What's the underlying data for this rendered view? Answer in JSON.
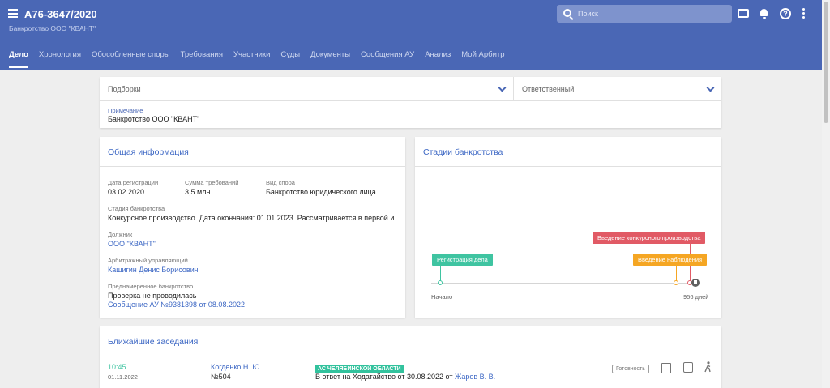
{
  "header": {
    "case_number": "А76-3647/2020",
    "subtitle": "Банкротство ООО \"КВАНТ\"",
    "search_placeholder": "Поиск",
    "tabs": [
      {
        "label": "Дело",
        "active": true
      },
      {
        "label": "Хронология",
        "active": false
      },
      {
        "label": "Обособленные споры",
        "active": false
      },
      {
        "label": "Требования",
        "active": false
      },
      {
        "label": "Участники",
        "active": false
      },
      {
        "label": "Суды",
        "active": false
      },
      {
        "label": "Документы",
        "active": false
      },
      {
        "label": "Сообщения АУ",
        "active": false
      },
      {
        "label": "Анализ",
        "active": false
      },
      {
        "label": "Мой Арбитр",
        "active": false
      }
    ],
    "help_glyph": "?",
    "icons": [
      "menu-icon",
      "search-icon",
      "chat-icon",
      "bell-icon",
      "help-icon",
      "more-icon"
    ]
  },
  "filters": {
    "collections_label": "Подборки",
    "responsible_label": "Ответственный",
    "note_label": "Примечание",
    "note_value": "Банкротство ООО \"КВАНТ\""
  },
  "info": {
    "title": "Общая информация",
    "reg_date_label": "Дата регистрации",
    "reg_date": "03.02.2020",
    "claims_label": "Сумма требований",
    "claims": "3,5 млн",
    "dispute_label": "Вид спора",
    "dispute": "Банкротство юридического лица",
    "stage_label": "Стадия банкротства",
    "stage": "Конкурсное производство. Дата окончания: 01.01.2023. Рассматривается в первой и...",
    "debtor_label": "Должник",
    "debtor": "ООО \"КВАНТ\"",
    "manager_label": "Арбитражный управляющий",
    "manager": "Кашигин Денис Борисович",
    "intent_label": "Преднамеренное банкротство",
    "intent_value": "Проверка не проводилась",
    "intent_link": "Сообщение АУ №9381398 от 08.08.2022"
  },
  "stages": {
    "title": "Стадии банкротства",
    "start_label": "Начало",
    "end_label": "956 дней",
    "events": [
      {
        "label": "Регистрация дела",
        "color": "#3fc4a1"
      },
      {
        "label": "Введение конкурсного производства",
        "color": "#e15a65"
      },
      {
        "label": "Введение наблюдения",
        "color": "#f5a623"
      }
    ]
  },
  "meetings": {
    "title": "Ближайшие заседания",
    "rows": [
      {
        "time": "10:45",
        "date": "01.11.2022",
        "judge": "Когденко Н. Ю.",
        "room": "№504",
        "court": "АС ЧЕЛЯБИНСКОЙ ОБЛАСТИ",
        "description": "В ответ на Ходатайство от 30.08.2022 от",
        "party": "Жаров В. В.",
        "status": "Готовность"
      }
    ]
  },
  "colors": {
    "brand": "#4a67b5",
    "link": "#3c67c4"
  }
}
